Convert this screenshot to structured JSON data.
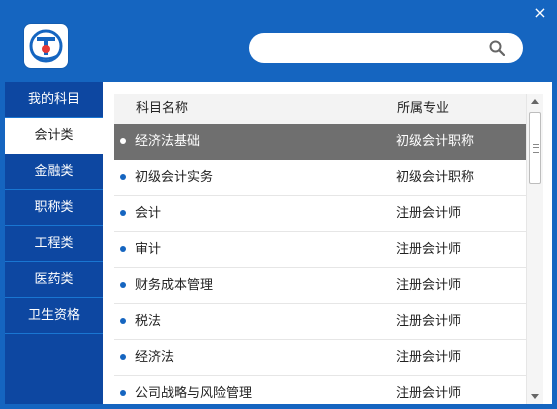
{
  "window": {
    "close_label": "×",
    "colors": {
      "header_bg": "#1565C0",
      "sidebar_bg": "#0D47A1",
      "selected_row_bg": "#6f6f6f",
      "bullet": "#1565C0"
    }
  },
  "search": {
    "value": "",
    "placeholder": ""
  },
  "sidebar": {
    "items": [
      {
        "label": "我的科目"
      },
      {
        "label": "会计类"
      },
      {
        "label": "金融类"
      },
      {
        "label": "职称类"
      },
      {
        "label": "工程类"
      },
      {
        "label": "医药类"
      },
      {
        "label": "卫生资格"
      }
    ],
    "active_index": 1
  },
  "table": {
    "headers": {
      "name": "科目名称",
      "major": "所属专业"
    },
    "rows": [
      {
        "name": "经济法基础",
        "major": "初级会计职称",
        "selected": true
      },
      {
        "name": "初级会计实务",
        "major": "初级会计职称"
      },
      {
        "name": "会计",
        "major": "注册会计师"
      },
      {
        "name": "审计",
        "major": "注册会计师"
      },
      {
        "name": "财务成本管理",
        "major": "注册会计师"
      },
      {
        "name": "税法",
        "major": "注册会计师"
      },
      {
        "name": "经济法",
        "major": "注册会计师"
      },
      {
        "name": "公司战略与风险管理",
        "major": "注册会计师"
      }
    ]
  },
  "scroll": {
    "thumb_label": "≡"
  }
}
